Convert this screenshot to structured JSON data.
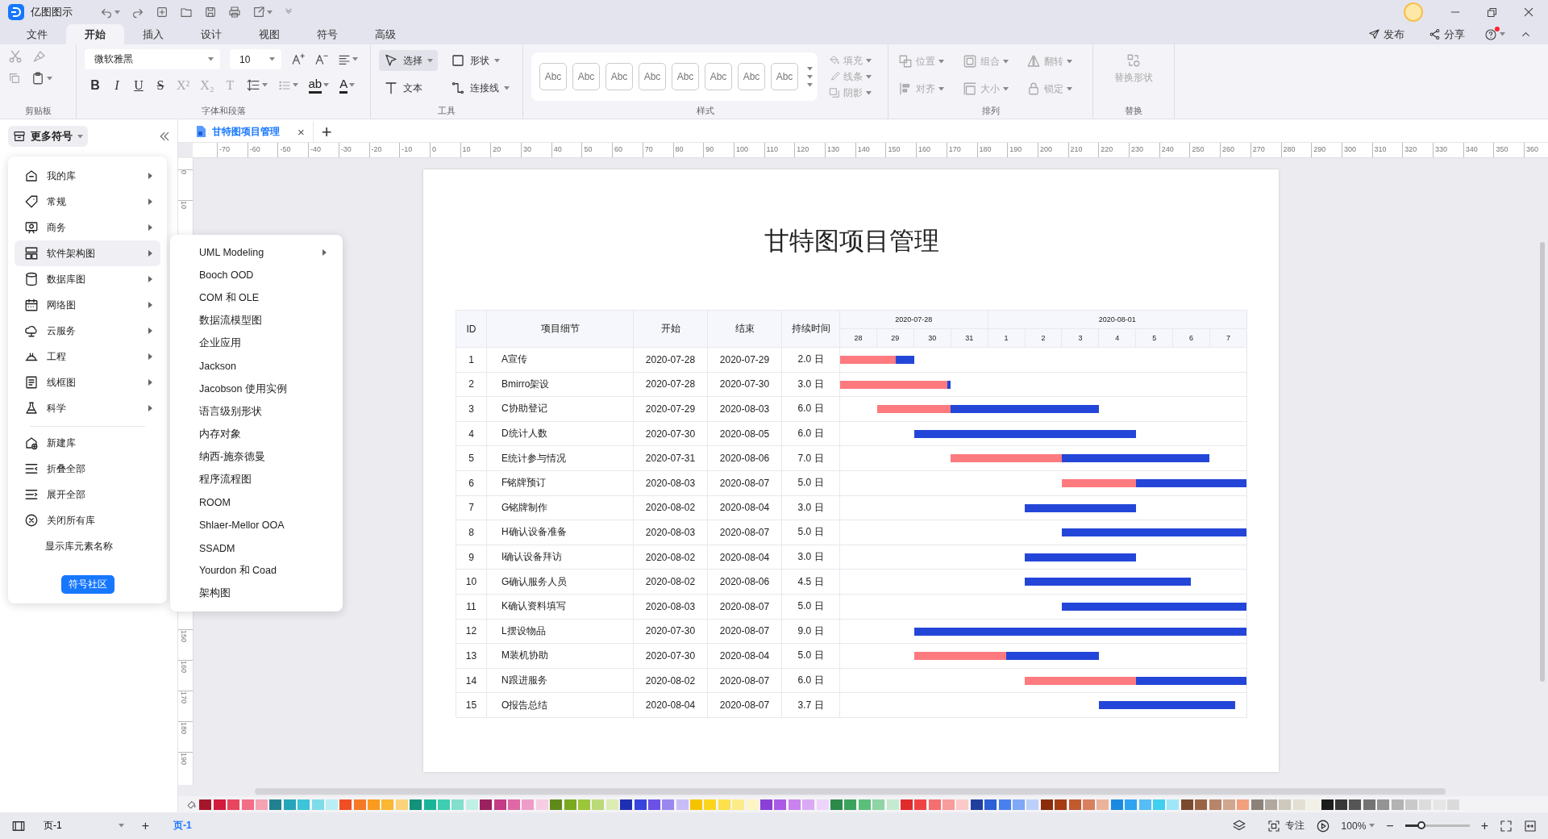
{
  "title_bar": {
    "app_name": "亿图图示"
  },
  "menu_tabs": [
    {
      "label": "文件",
      "selected": false
    },
    {
      "label": "开始",
      "selected": true
    },
    {
      "label": "插入",
      "selected": false
    },
    {
      "label": "设计",
      "selected": false
    },
    {
      "label": "视图",
      "selected": false
    },
    {
      "label": "符号",
      "selected": false
    },
    {
      "label": "高级",
      "selected": false
    }
  ],
  "menu_actions": [
    "发布",
    "分享"
  ],
  "ribbon": {
    "groups": [
      "剪贴板",
      "字体和段落",
      "工具",
      "样式",
      "排列",
      "替换"
    ],
    "font_name": "微软雅黑",
    "font_size": "10",
    "format_glyphs": [
      {
        "kind": "bold",
        "glyph": "B"
      },
      {
        "kind": "italic",
        "glyph": "I"
      },
      {
        "kind": "underline",
        "glyph": "U"
      },
      {
        "kind": "strike",
        "glyph": "S"
      },
      {
        "kind": "sup",
        "glyph": "X²"
      },
      {
        "kind": "sub",
        "glyph": "X₂"
      },
      {
        "kind": "plain",
        "glyph": "T"
      }
    ],
    "color_glyphs": [
      "ab",
      "A"
    ],
    "tools": [
      {
        "label": "选择",
        "selected": true
      },
      {
        "label": "形状",
        "selected": false
      },
      {
        "label": "文本",
        "selected": false
      },
      {
        "label": "连接线",
        "selected": false
      }
    ],
    "style_samples": [
      "Abc",
      "Abc",
      "Abc",
      "Abc",
      "Abc",
      "Abc",
      "Abc",
      "Abc"
    ],
    "style_props": [
      {
        "label": "填充",
        "disabled": true
      },
      {
        "label": "线条",
        "disabled": true
      },
      {
        "label": "阴影",
        "disabled": true
      }
    ],
    "arrange": [
      {
        "label": "位置",
        "disabled": true
      },
      {
        "label": "组合",
        "disabled": true
      },
      {
        "label": "翻转",
        "disabled": true
      },
      {
        "label": "对齐",
        "disabled": true
      },
      {
        "label": "大小",
        "disabled": true
      },
      {
        "label": "锁定",
        "disabled": true
      }
    ],
    "replace": {
      "label": "替换形状",
      "disabled": true
    }
  },
  "library_panel": {
    "title": "更多符号",
    "items": [
      {
        "kind": "category",
        "label": "我的库",
        "selected": false
      },
      {
        "kind": "category",
        "label": "常规",
        "selected": false
      },
      {
        "kind": "category",
        "label": "商务",
        "selected": false
      },
      {
        "kind": "category",
        "label": "软件架构图",
        "selected": true
      },
      {
        "kind": "category",
        "label": "数据库图",
        "selected": false
      },
      {
        "kind": "category",
        "label": "网络图",
        "selected": false
      },
      {
        "kind": "category",
        "label": "云服务",
        "selected": false
      },
      {
        "kind": "category",
        "label": "工程",
        "selected": false
      },
      {
        "kind": "category",
        "label": "线框图",
        "selected": false
      },
      {
        "kind": "category",
        "label": "科学",
        "selected": false
      },
      {
        "kind": "action",
        "label": "新建库",
        "selected": false
      },
      {
        "kind": "action",
        "label": "折叠全部",
        "selected": false
      },
      {
        "kind": "action",
        "label": "展开全部",
        "selected": false
      },
      {
        "kind": "action",
        "label": "关闭所有库",
        "selected": false
      },
      {
        "kind": "action",
        "label": "显示库元素名称",
        "selected": false
      }
    ],
    "community_button": "符号社区"
  },
  "submenu": [
    {
      "label": "UML Modeling",
      "has_submenu": true
    },
    {
      "label": "Booch OOD",
      "has_submenu": false
    },
    {
      "label": "COM 和 OLE",
      "has_submenu": false
    },
    {
      "label": "数据流模型图",
      "has_submenu": false
    },
    {
      "label": "企业应用",
      "has_submenu": false
    },
    {
      "label": "Jackson",
      "has_submenu": false
    },
    {
      "label": "Jacobson 使用实例",
      "has_submenu": false
    },
    {
      "label": "语言级别形状",
      "has_submenu": false
    },
    {
      "label": "内存对象",
      "has_submenu": false
    },
    {
      "label": "纳西-施奈德曼",
      "has_submenu": false
    },
    {
      "label": "程序流程图",
      "has_submenu": false
    },
    {
      "label": "ROOM",
      "has_submenu": false
    },
    {
      "label": "Shlaer-Mellor OOA",
      "has_submenu": false
    },
    {
      "label": "SSADM",
      "has_submenu": false
    },
    {
      "label": "Yourdon 和 Coad",
      "has_submenu": false
    },
    {
      "label": "架构图",
      "has_submenu": false
    }
  ],
  "document_tab": {
    "title": "甘特图项目管理",
    "close": "×",
    "new_tab": "+"
  },
  "ruler": {
    "horizontal": [
      "-70",
      "-60",
      "-50",
      "-40",
      "-30",
      "-20",
      "-10",
      "0",
      "10",
      "20",
      "30",
      "40",
      "50",
      "60",
      "70",
      "80",
      "90",
      "100",
      "110",
      "120",
      "130",
      "140",
      "150",
      "160",
      "170",
      "180",
      "190",
      "200",
      "210",
      "220",
      "230",
      "240",
      "250",
      "260",
      "270",
      "280",
      "290",
      "300",
      "310",
      "320",
      "330",
      "340",
      "350",
      "360"
    ],
    "vertical": [
      "0",
      "10",
      "150",
      "160",
      "170",
      "180",
      "190"
    ]
  },
  "page": {
    "title": "甘特图项目管理",
    "columns": [
      "ID",
      "项目细节",
      "开始",
      "结束",
      "持续时间"
    ],
    "periods": [
      {
        "label": "2020-07-28",
        "days": [
          "28",
          "29",
          "30",
          "31"
        ]
      },
      {
        "label": "2020-08-01",
        "days": [
          "1",
          "2",
          "3",
          "4",
          "5",
          "6",
          "7"
        ]
      }
    ],
    "rows": [
      {
        "id": "1",
        "task": "A宣传",
        "start": "2020-07-28",
        "end": "2020-07-29",
        "duration": "2.0 日",
        "level": 0.75
      },
      {
        "id": "2",
        "task": "Bmirro架设",
        "start": "2020-07-28",
        "end": "2020-07-30",
        "duration": "3.0 日",
        "level": 0.97
      },
      {
        "id": "3",
        "task": "C协助登记",
        "start": "2020-07-29",
        "end": "2020-08-03",
        "duration": "6.0 日",
        "level": 0.33
      },
      {
        "id": "4",
        "task": "D统计人数",
        "start": "2020-07-30",
        "end": "2020-08-05",
        "duration": "6.0 日"
      },
      {
        "id": "5",
        "task": "E统计参与情况",
        "start": "2020-07-31",
        "end": "2020-08-06",
        "duration": "7.0 日",
        "level": 0.43
      },
      {
        "id": "6",
        "task": "F铭牌预订",
        "start": "2020-08-03",
        "end": "2020-08-07",
        "duration": "5.0 日",
        "level": 0.4
      },
      {
        "id": "7",
        "task": "G铭牌制作",
        "start": "2020-08-02",
        "end": "2020-08-04",
        "duration": "3.0 日"
      },
      {
        "id": "8",
        "task": "H确认设备准备",
        "start": "2020-08-03",
        "end": "2020-08-07",
        "duration": "5.0 日"
      },
      {
        "id": "9",
        "task": "I确认设备拜访",
        "start": "2020-08-02",
        "end": "2020-08-04",
        "duration": "3.0 日"
      },
      {
        "id": "10",
        "task": "G确认服务人员",
        "start": "2020-08-02",
        "end": "2020-08-06",
        "duration": "4.5 日"
      },
      {
        "id": "11",
        "task": "K确认资料填写",
        "start": "2020-08-03",
        "end": "2020-08-07",
        "duration": "5.0 日"
      },
      {
        "id": "12",
        "task": "L摆设物品",
        "start": "2020-07-30",
        "end": "2020-08-07",
        "duration": "9.0 日"
      },
      {
        "id": "13",
        "task": "M装机协助",
        "start": "2020-07-30",
        "end": "2020-08-04",
        "duration": "5.0 日",
        "level": 0.5
      },
      {
        "id": "14",
        "task": "N跟进服务",
        "start": "2020-08-02",
        "end": "2020-08-07",
        "duration": "6.0 日",
        "level": 0.5
      },
      {
        "id": "15",
        "task": "O报告总结",
        "start": "2020-08-04",
        "end": "2020-08-07",
        "duration": "3.7 日"
      }
    ]
  },
  "palette": [
    {
      "color": "#a5162a"
    },
    {
      "color": "#d21a3c"
    },
    {
      "color": "#e8465e"
    },
    {
      "color": "#f26d85"
    },
    {
      "color": "#f5a3b3"
    },
    {
      "color": "#23818f"
    },
    {
      "color": "#25a5b8"
    },
    {
      "color": "#3cc4d9"
    },
    {
      "color": "#7ddcea"
    },
    {
      "color": "#b9eef5"
    },
    {
      "color": "#f04e23"
    },
    {
      "color": "#f57a25"
    },
    {
      "color": "#fa9a1e"
    },
    {
      "color": "#fbb632"
    },
    {
      "color": "#fcd27a"
    },
    {
      "color": "#13917a"
    },
    {
      "color": "#1ab598"
    },
    {
      "color": "#3fcdb1"
    },
    {
      "color": "#80e0cc"
    },
    {
      "color": "#bff0e5"
    },
    {
      "color": "#9a2060"
    },
    {
      "color": "#c43b86"
    },
    {
      "color": "#e067a6"
    },
    {
      "color": "#ee9dc8"
    },
    {
      "color": "#f6cde2"
    },
    {
      "color": "#5f8a1a"
    },
    {
      "color": "#7aa91f"
    },
    {
      "color": "#9bc63a"
    },
    {
      "color": "#bcd977"
    },
    {
      "color": "#dcecb5"
    },
    {
      "color": "#1f2fb3"
    },
    {
      "color": "#3646dc"
    },
    {
      "color": "#6a52e6"
    },
    {
      "color": "#9a88f0"
    },
    {
      "color": "#c8bdf7"
    },
    {
      "color": "#f5c400"
    },
    {
      "color": "#fbd51d"
    },
    {
      "color": "#fce04c"
    },
    {
      "color": "#fdeb88"
    },
    {
      "color": "#fef5c4"
    },
    {
      "color": "#8a3fd6"
    },
    {
      "color": "#a95ae6"
    },
    {
      "color": "#c983ef"
    },
    {
      "color": "#dbaaf4"
    },
    {
      "color": "#edd5fa"
    },
    {
      "color": "#2b8a4a"
    },
    {
      "color": "#3ca35c"
    },
    {
      "color": "#5bbf7a"
    },
    {
      "color": "#8ed4a4"
    },
    {
      "color": "#c4ead0"
    },
    {
      "color": "#e02b2b"
    },
    {
      "color": "#ef4343"
    },
    {
      "color": "#f46f6f"
    },
    {
      "color": "#f89b9b"
    },
    {
      "color": "#fcc9c9"
    },
    {
      "color": "#1f3f9e"
    },
    {
      "color": "#2d5fd6"
    },
    {
      "color": "#4a80ee"
    },
    {
      "color": "#80a8f4"
    },
    {
      "color": "#bcd0f9"
    },
    {
      "color": "#8a2c0c"
    },
    {
      "color": "#a63d12"
    },
    {
      "color": "#c25a30"
    },
    {
      "color": "#d8805f"
    },
    {
      "color": "#ebb39c"
    },
    {
      "color": "#1a8ae0"
    },
    {
      "color": "#2ea3f0"
    },
    {
      "color": "#57bdf5"
    },
    {
      "color": "#3fd0f0"
    },
    {
      "color": "#9fe6f8"
    },
    {
      "color": "#7b4a2e"
    },
    {
      "color": "#9a6444"
    },
    {
      "color": "#b7856a"
    },
    {
      "color": "#d0a78e"
    },
    {
      "color": "#f2a07c"
    },
    {
      "color": "#8c8279"
    },
    {
      "color": "#b0a89e"
    },
    {
      "color": "#cfc8bd"
    },
    {
      "color": "#e4dfd3"
    },
    {
      "color": "#f3f0e6"
    },
    {
      "color": "#1c1c1c"
    },
    {
      "color": "#383838"
    },
    {
      "color": "#555555"
    },
    {
      "color": "#737373"
    },
    {
      "color": "#949494"
    },
    {
      "color": "#b3b3b3"
    },
    {
      "color": "#c9c9c9"
    },
    {
      "color": "#dcdcdc"
    },
    {
      "color": "#e6e6e6"
    },
    {
      "color": "#dadada"
    }
  ],
  "status_bar": {
    "page_select": "页-1",
    "add_page": "+",
    "page_tabs": [
      {
        "label": "页-1",
        "selected": true
      }
    ],
    "focus": "专注",
    "zoom": "100%",
    "zoom_out": "−",
    "zoom_in": "+",
    "zoom_slider": {
      "level": 0.25
    }
  }
}
